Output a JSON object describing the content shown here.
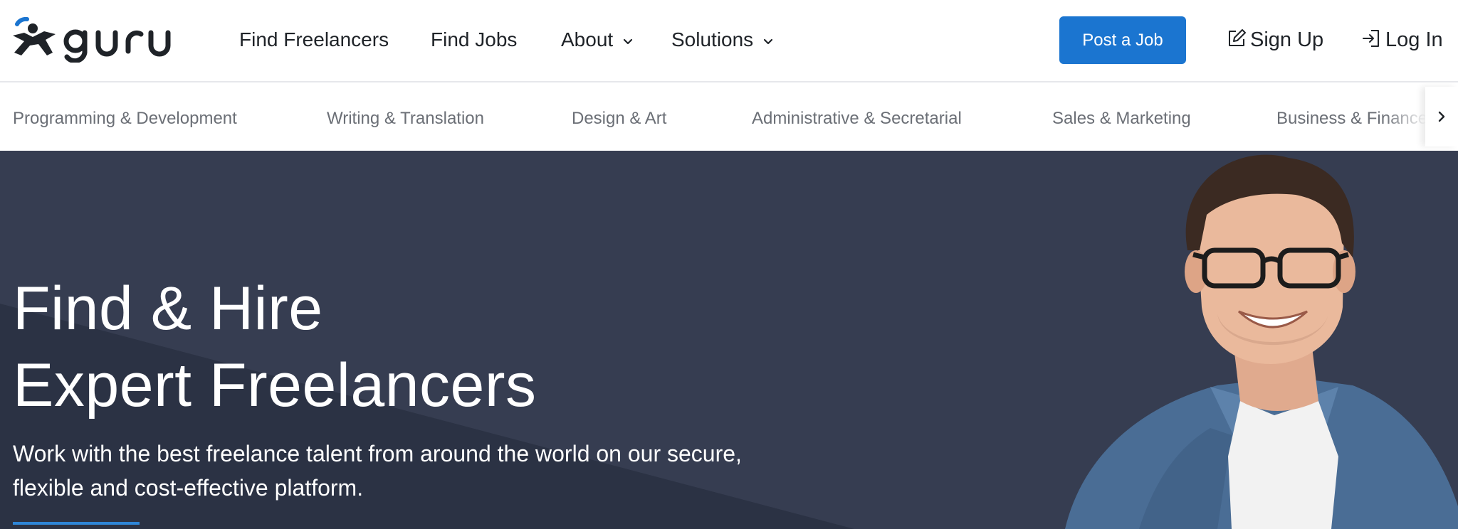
{
  "brand": {
    "name": "guru",
    "accent_color": "#1b75d0",
    "logo_dot_color": "#1b75d0"
  },
  "header": {
    "nav": [
      {
        "label": "Find Freelancers",
        "has_dropdown": false
      },
      {
        "label": "Find Jobs",
        "has_dropdown": false
      },
      {
        "label": "About",
        "has_dropdown": true
      },
      {
        "label": "Solutions",
        "has_dropdown": true
      }
    ],
    "post_job_label": "Post a Job",
    "sign_up": {
      "label": "Sign Up",
      "icon": "edit-icon"
    },
    "log_in": {
      "label": "Log In",
      "icon": "login-icon"
    }
  },
  "categories": {
    "items": [
      "Programming & Development",
      "Writing & Translation",
      "Design & Art",
      "Administrative & Secretarial",
      "Sales & Marketing",
      "Business & Finance"
    ],
    "next_icon": "chevron-right-icon"
  },
  "hero": {
    "title_line1": "Find & Hire",
    "title_line2": "Expert Freelancers",
    "subtitle_line1": "Work with the best freelance talent from around the world on our secure,",
    "subtitle_line2": "flexible and cost-effective platform.",
    "background_color": "#363d51",
    "accent_line_color": "#2e86d8",
    "image": "smiling-man-with-glasses-photo"
  }
}
